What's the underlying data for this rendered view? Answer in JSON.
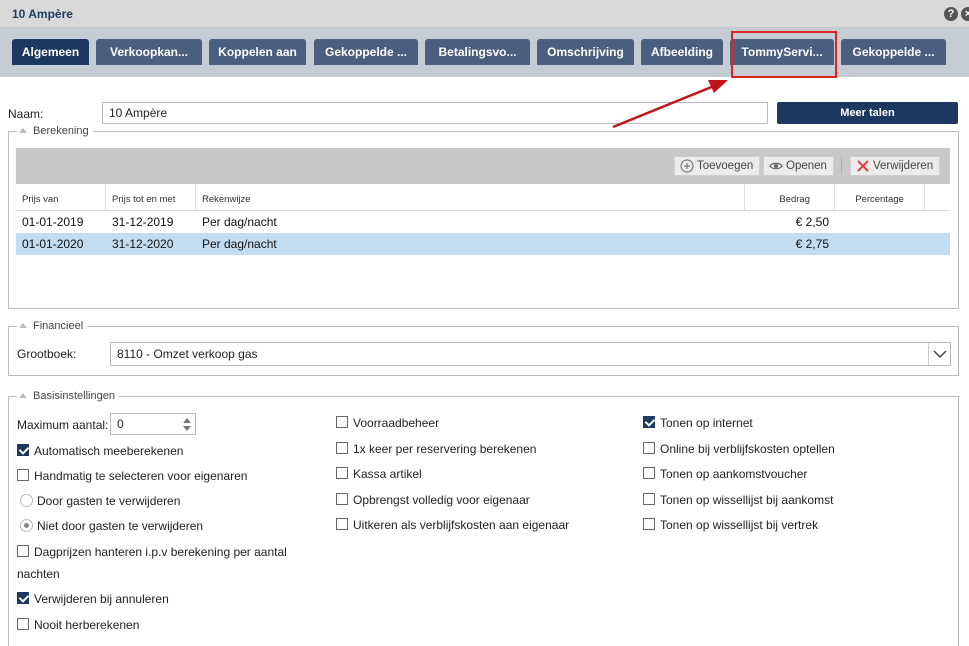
{
  "window": {
    "title": "10 Ampère",
    "help_icon": "?",
    "close_icon": "×"
  },
  "tabs": [
    {
      "label": "Algemeen",
      "active": true
    },
    {
      "label": "Verkoopkan..."
    },
    {
      "label": "Koppelen aan"
    },
    {
      "label": "Gekoppelde ..."
    },
    {
      "label": "Betalingsvo..."
    },
    {
      "label": "Omschrijving"
    },
    {
      "label": "Afbeelding"
    },
    {
      "label": "TommyServi...",
      "highlighted": true
    },
    {
      "label": "Gekoppelde ..."
    }
  ],
  "name_field": {
    "label": "Naam:",
    "value": "10 Ampère",
    "more_languages_button": "Meer talen"
  },
  "berekening": {
    "legend": "Berekening",
    "toolbar": {
      "add": "Toevoegen",
      "open": "Openen",
      "delete": "Verwijderen"
    },
    "columns": [
      "Prijs van",
      "Prijs tot en met",
      "Rekenwijze",
      "Bedrag",
      "Percentage"
    ],
    "rows": [
      {
        "from": "01-01-2019",
        "to": "31-12-2019",
        "method": "Per dag/nacht",
        "amount": "€ 2,50",
        "percentage": ""
      },
      {
        "from": "01-01-2020",
        "to": "31-12-2020",
        "method": "Per dag/nacht",
        "amount": "€ 2,75",
        "percentage": "",
        "selected": true
      }
    ]
  },
  "financieel": {
    "legend": "Financieel",
    "ledger_label": "Grootboek:",
    "ledger_value": "8110 - Omzet verkoop gas"
  },
  "basisinstellingen": {
    "legend": "Basisinstellingen",
    "max_label": "Maximum aantal:",
    "max_value": "0",
    "col1": {
      "auto_recalc": {
        "label": "Automatisch meeberekenen",
        "checked": true
      },
      "manual_select": {
        "label": "Handmatig te selecteren voor eigenaren",
        "checked": false
      },
      "radio_guests_delete": {
        "label": "Door gasten te verwijderen",
        "checked": false
      },
      "radio_guests_nodelete": {
        "label": "Niet door gasten te verwijderen",
        "checked": true
      },
      "day_prices": {
        "label": "Dagprijzen hanteren i.p.v berekening per aantal",
        "label_line2": "nachten",
        "checked": false
      },
      "delete_on_cancel": {
        "label": "Verwijderen bij annuleren",
        "checked": true
      },
      "never_recalc": {
        "label": "Nooit herberekenen",
        "checked": false
      }
    },
    "col2": [
      {
        "label": "Voorraadbeheer",
        "checked": false
      },
      {
        "label": "1x keer per reservering berekenen",
        "checked": false
      },
      {
        "label": "Kassa artikel",
        "checked": false
      },
      {
        "label": "Opbrengst volledig voor eigenaar",
        "checked": false
      },
      {
        "label": "Uitkeren als verblijfskosten aan eigenaar",
        "checked": false
      }
    ],
    "col3": [
      {
        "label": "Tonen op internet",
        "checked": true
      },
      {
        "label": "Online bij verblijfskosten optellen",
        "checked": false
      },
      {
        "label": "Tonen op aankomstvoucher",
        "checked": false
      },
      {
        "label": "Tonen op wissellijst bij aankomst",
        "checked": false
      },
      {
        "label": "Tonen op wissellijst bij vertrek",
        "checked": false
      }
    ]
  },
  "colors": {
    "primary": "#1c3760",
    "tab": "#4a5f7e",
    "selected_row": "#c2dcf2",
    "annotation_red": "#c0141a"
  }
}
